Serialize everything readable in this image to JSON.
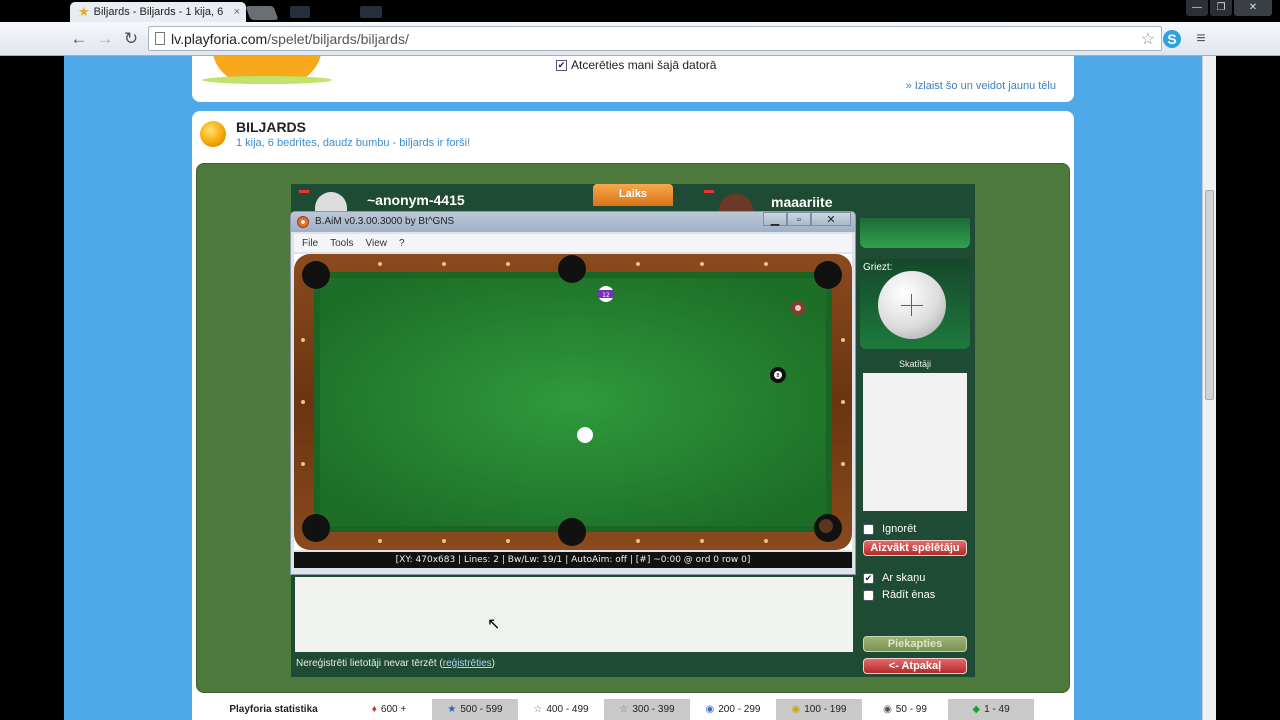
{
  "browser": {
    "tab_title": "Biljards - Biljards - 1 kija, 6",
    "tab_close": "×",
    "url_host": "lv.playforia.com",
    "url_path": "/spelet/biljards/biljards/",
    "win_min": "—",
    "win_max": "❐",
    "win_close": "✕"
  },
  "header": {
    "remember_label": "Atcerēties mani šajā datorā",
    "alt_link": "» Izlaist šo un veidot jaunu tēlu"
  },
  "game": {
    "title": "BILJARDS",
    "subtitle": "1 kija, 6 bedrītes, daudz bumbu - biljards ir forši!",
    "player1": "~anonym-4415",
    "player2": "maaariite",
    "timer_label": "Laiks",
    "spin_label": "Griezt:",
    "spectators_label": "Skatītāji",
    "ignore_label": "Ignorēt",
    "kick_button": "Aizvākt spēlētāju",
    "sound_label": "Ar skaņu",
    "shadows_label": "Rādīt ēnas",
    "join_button": "Piekapties",
    "back_button": "<- Atpakaļ",
    "chat_note": "Nereģistrēti lietotāji nevar tērzēt",
    "register_link": "reģistrēties"
  },
  "baim": {
    "title": "B.AiM v0.3.00.3000 by Bt^GNS",
    "menu": [
      "File",
      "Tools",
      "View",
      "?"
    ],
    "status": "[XY: 470x683 | Lines: 2 | Bw/Lw: 19/1 | AutoAim: off | [#] ~0:00 @ ord 0 row 0]",
    "ball_labels": [
      "12",
      "8"
    ]
  },
  "stats": {
    "label": "Playforia statistika",
    "ranges": [
      {
        "text": "600 +",
        "icon": "♦",
        "color": "#c0392b"
      },
      {
        "text": "500 - 599",
        "icon": "★",
        "color": "#2f5fbf"
      },
      {
        "text": "400 - 499",
        "icon": "☆",
        "color": "#777"
      },
      {
        "text": "300 - 399",
        "icon": "☆",
        "color": "#777"
      },
      {
        "text": "200 - 299",
        "icon": "◉",
        "color": "#3a6fd1"
      },
      {
        "text": "100 - 199",
        "icon": "◉",
        "color": "#c9a800"
      },
      {
        "text": "50 - 99",
        "icon": "◉",
        "color": "#555"
      },
      {
        "text": "1 - 49",
        "icon": "◆",
        "color": "#1aa32a"
      }
    ]
  }
}
